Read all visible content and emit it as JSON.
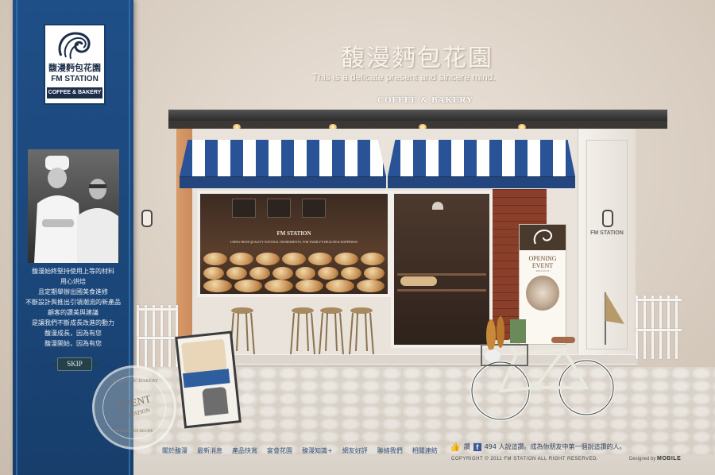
{
  "sidebar": {
    "logo": {
      "chinese": "馥漫麪包花園",
      "english": "FM STATION",
      "subtitle": "COFFEE & BAKERY"
    },
    "intro_lines": [
      "馥漫始終堅持使用上等的材料",
      "用心烘焙",
      "且定期舉辦出國美食進修",
      "不斷設計與推出引領潮流的新產品",
      "顧客的讚美與建議",
      "是讓我們不斷成長改進的動力",
      "馥漫成長，因為有您",
      "馥漫開始，因為有您"
    ],
    "skip_label": "SKIP"
  },
  "header": {
    "brand_chinese": "馥漫麪包花園",
    "tagline": "This is a delicate present and sincere mind.",
    "store_sign": "COFFEE & BAKERY"
  },
  "storefront": {
    "window_label": "FM STATION",
    "window_sub": "USING HIGH QUALITY NATURAL INGREDIENTS, FOR FAMILY'S HEALTH & HAPPINESS",
    "pillar_label": "FM STATION",
    "event_board_title": "OPENING EVENT",
    "event_board_date": "2011.6.15~12"
  },
  "stamp": {
    "top_text": "AUTHENTIC BAKERY",
    "center_text": "EVENT",
    "center_sub": "FM STATION",
    "bottom_text": "HOMEMADE RECIPE"
  },
  "footer": {
    "nav": [
      "關於馥漫",
      "最新消息",
      "產品快賞",
      "宴會花園",
      "馥漫知識+",
      "網友好評",
      "聯絡我們",
      "相關連結"
    ],
    "like_label": "讚",
    "like_count_text": "494 人說這讚。成為你朋友中第一個說這讚的人。",
    "copyright": "COPYRIGHT © 2011 FM STATION ALL RIGHT RESERVED.",
    "designed_by": "Designed by",
    "designer": "MOBILE"
  },
  "colors": {
    "sidebar_blue": "#1f4f87",
    "awning_blue": "#2a5296",
    "facebook_blue": "#3b5998"
  }
}
